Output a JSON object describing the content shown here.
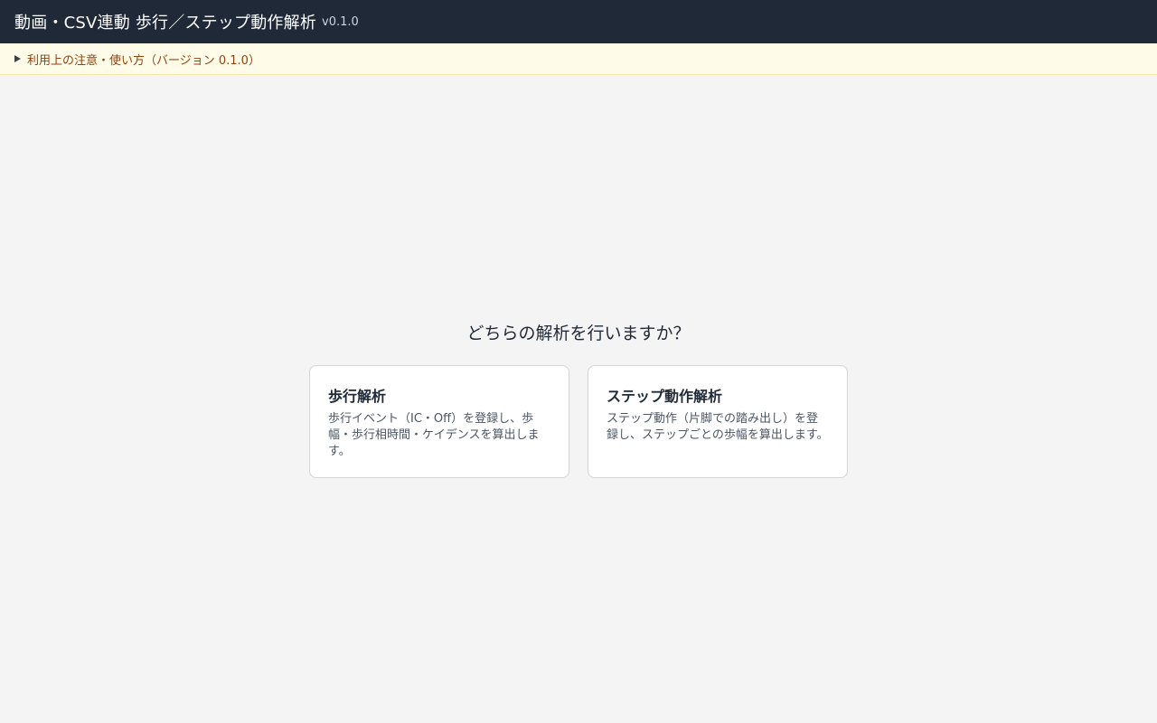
{
  "header": {
    "title": "動画・CSV連動 歩行／ステップ動作解析",
    "version": "v0.1.0"
  },
  "notice": {
    "label": "利用上の注意・使い方（バージョン 0.1.0）",
    "icon": "triangle-right-icon"
  },
  "main": {
    "question": "どちらの解析を行いますか？",
    "cards": [
      {
        "title": "歩行解析",
        "description": "歩行イベント（IC・Off）を登録し、歩幅・歩行相時間・ケイデンスを算出します。"
      },
      {
        "title": "ステップ動作解析",
        "description": "ステップ動作（片脚での踏み出し）を登録し、ステップごとの歩幅を算出します。"
      }
    ]
  },
  "colors": {
    "header_bg": "#1f2937",
    "notice_bg": "#fefce8",
    "notice_text": "#92400e",
    "page_bg": "#f4f4f5",
    "card_bg": "#ffffff"
  }
}
